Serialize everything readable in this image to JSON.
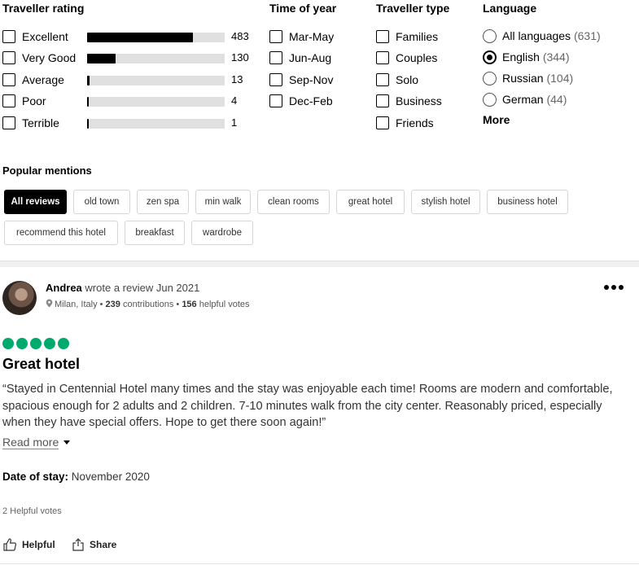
{
  "filters": {
    "rating": {
      "title": "Traveller rating",
      "items": [
        {
          "label": "Excellent",
          "count": "483",
          "fill": 0.77
        },
        {
          "label": "Very Good",
          "count": "130",
          "fill": 0.21
        },
        {
          "label": "Average",
          "count": "13",
          "fill": 0.02
        },
        {
          "label": "Poor",
          "count": "4",
          "fill": 0.01
        },
        {
          "label": "Terrible",
          "count": "1",
          "fill": 0.01
        }
      ]
    },
    "time": {
      "title": "Time of year",
      "items": [
        "Mar-May",
        "Jun-Aug",
        "Sep-Nov",
        "Dec-Feb"
      ]
    },
    "type": {
      "title": "Traveller type",
      "items": [
        "Families",
        "Couples",
        "Solo",
        "Business",
        "Friends"
      ]
    },
    "language": {
      "title": "Language",
      "items": [
        {
          "label": "All languages",
          "count": "(631)",
          "selected": false
        },
        {
          "label": "English",
          "count": "(344)",
          "selected": true
        },
        {
          "label": "Russian",
          "count": "(104)",
          "selected": false
        },
        {
          "label": "German",
          "count": "(44)",
          "selected": false
        }
      ],
      "more": "More"
    }
  },
  "popular": {
    "title": "Popular mentions",
    "chips": [
      "All reviews",
      "old town",
      "zen spa",
      "min walk",
      "clean rooms",
      "great hotel",
      "stylish hotel",
      "business hotel",
      "recommend this hotel",
      "breakfast",
      "wardrobe"
    ],
    "active_index": 0
  },
  "review": {
    "author": "Andrea",
    "action_text": "wrote a review Jun 2021",
    "location": "Milan, Italy",
    "contributions": "239",
    "contributions_label": "contributions",
    "helpful_votes": "156",
    "helpful_votes_label": "helpful votes",
    "rating": 5,
    "title": "Great hotel",
    "text": "“Stayed in Centennial Hotel many times and the stay was enjoyable each time! Rooms are modern and comfortable, spacious enough for 2 adults and 2 children. 7-10 minutes walk from the city center. Reasonably priced, especially when they have special offers. Hope to get there soon again!”",
    "read_more": "Read more",
    "date_label": "Date of stay:",
    "date_value": "November 2020",
    "helpful_count": "2 Helpful votes",
    "helpful_button": "Helpful",
    "share_button": "Share"
  },
  "colors": {
    "rating_bubble": "#00aa6c",
    "bar_fill": "#000000",
    "bar_track": "#e0e0e0",
    "chip_active": "#000000"
  }
}
